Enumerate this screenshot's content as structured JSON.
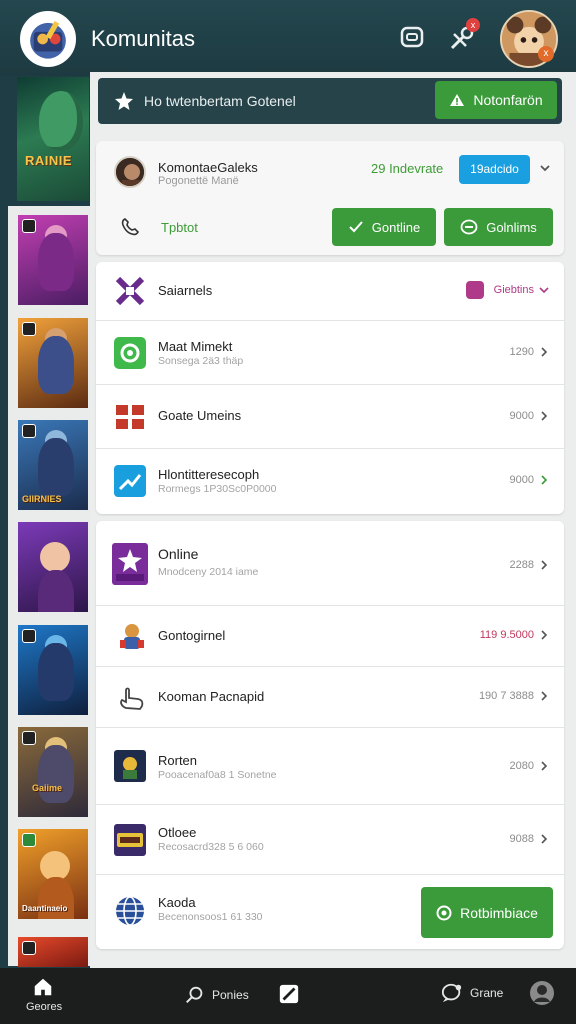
{
  "app": {
    "title": "Komunitas"
  },
  "header": {
    "notification_badge": "x",
    "user_badge": "x"
  },
  "notice": {
    "text": "Ho twtenbertam Gotenel",
    "button_label": "Notonfarön"
  },
  "community": {
    "name": "KomontaeGaleks",
    "subtitle": "Pogonettë Manë",
    "online": "29 Indevrate",
    "tag": "19adcido",
    "call_label": "Tpbtot",
    "continue_label": "Gontline",
    "online_button_label": "Golnlims"
  },
  "list_a": [
    {
      "title": "Saiarnels",
      "subtitle": "",
      "value": "Giebtins",
      "value_color": "#b03a8a"
    },
    {
      "title": "Maat Mimekt",
      "subtitle": "Sonsega 2ä3 thäp",
      "value": "1290",
      "value_color": "#8c8c8c"
    },
    {
      "title": "Goate Umeins",
      "subtitle": "",
      "value": "9000",
      "value_color": "#8c8c8c"
    },
    {
      "title": "Hlontitteresecoph",
      "subtitle": "Rormegs 1P30Sc0P0000",
      "value": "9000",
      "value_color": "#8c8c8c"
    }
  ],
  "list_b": [
    {
      "title": "Online",
      "subtitle": "Mnodceny 2014 iame",
      "value": "2288",
      "value_color": "#8c8c8c"
    },
    {
      "title": "Gontogirnel",
      "subtitle": "",
      "value": "119 9.5000",
      "value_color": "#c0395a"
    },
    {
      "title": "Kooman Pacnapid",
      "subtitle": "",
      "value": "190 7 3888",
      "value_color": "#8c8c8c"
    },
    {
      "title": "Rorten",
      "subtitle": "Pooacenaf0a8 1 Sonetne",
      "value": "2080",
      "value_color": "#8c8c8c"
    },
    {
      "title": "Otloee",
      "subtitle": "Recosacrd328 5 6 060",
      "value": "9088",
      "value_color": "#8c8c8c"
    },
    {
      "title": "Kaoda",
      "subtitle": "Becenonsoos1 61 330",
      "value": "",
      "value_color": "#8c8c8c"
    }
  ],
  "list_b_button": "Rotbimbiace",
  "games": {
    "banner_title": "RAINIE",
    "thumb_caption_3": "GIIRNIES",
    "thumb_caption_6": "Gaiime",
    "thumb_caption_7": "Daantinaeio"
  },
  "nav": {
    "home": "Geores",
    "search": "Ponies",
    "game": "Grane"
  },
  "colors": {
    "accent_green": "#3b9b3a",
    "header_bg": "#24474f",
    "tag_blue": "#1aa0e0"
  }
}
